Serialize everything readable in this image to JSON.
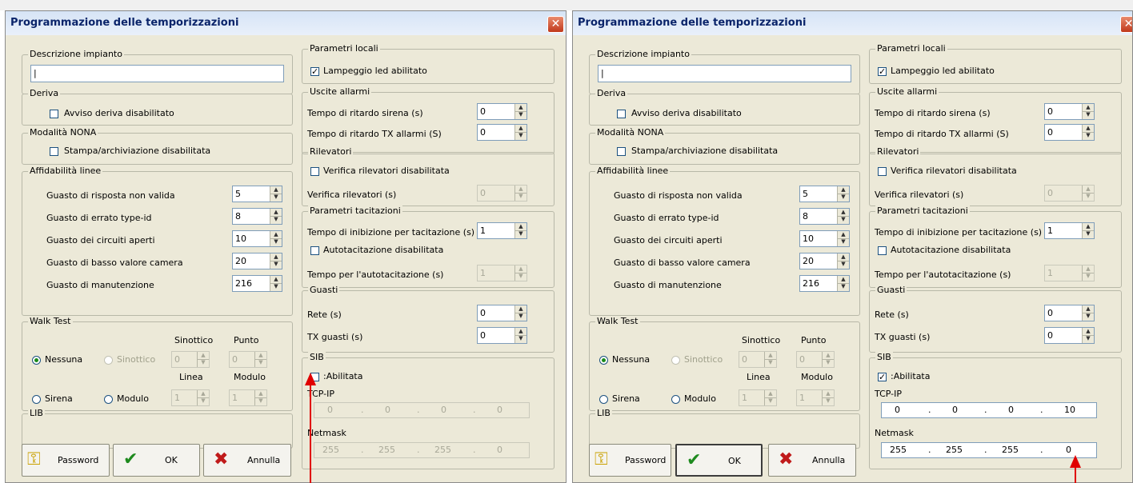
{
  "windows": [
    {
      "title": "Programmazione delle temporizzazioni",
      "close": "✕",
      "descrizione": {
        "label": "Descrizione impianto",
        "value": "|"
      },
      "deriva": {
        "label": "Deriva",
        "check_label": "Avviso deriva disabilitato"
      },
      "nona": {
        "label": "Modalità NONA",
        "check_label": "Stampa/archiviazione disabilitata"
      },
      "affidabilita": {
        "label": "Affidabilità linee",
        "rows": [
          {
            "label": "Guasto di risposta non valida",
            "value": "5"
          },
          {
            "label": "Guasto di errato type-id",
            "value": "8"
          },
          {
            "label": "Guasto dei circuiti aperti",
            "value": "10"
          },
          {
            "label": "Guasto di basso valore camera",
            "value": "20"
          },
          {
            "label": "Guasto di manutenzione",
            "value": "216"
          }
        ]
      },
      "walktest": {
        "label": "Walk Test",
        "sinottico_head": "Sinottico",
        "punto_head": "Punto",
        "linea_head": "Linea",
        "modulo_head": "Modulo",
        "radio_nessuna": "Nessuna",
        "radio_sinottico": "Sinottico",
        "radio_sirena": "Sirena",
        "radio_modulo": "Modulo",
        "sinottico_val": "0",
        "punto_val": "0",
        "linea_val": "1",
        "modulo_val": "1"
      },
      "lib": {
        "label": "LIB"
      },
      "buttons": {
        "password": "Password",
        "ok": "OK",
        "annulla": "Annulla"
      },
      "param_locali": {
        "label": "Parametri locali",
        "check_label": "Lampeggio led abilitato",
        "mark": "✓"
      },
      "uscite": {
        "label": "Uscite allarmi",
        "sirena_label": "Tempo di ritardo sirena (s)",
        "sirena_val": "0",
        "tx_label": "Tempo di ritardo TX allarmi (S)",
        "tx_val": "0"
      },
      "rilevatori": {
        "label": "Rilevatori",
        "check_label": "Verifica rilevatori disabilitata",
        "ver_label": "Verifica rilevatori (s)",
        "ver_val": "0"
      },
      "tacitazioni": {
        "label": "Parametri tacitazioni",
        "inib_label": "Tempo di inibizione per tacitazione (s)",
        "inib_val": "1",
        "check_label": "Autotacitazione disabilitata",
        "auto_label": "Tempo per l'autotacitazione (s)",
        "auto_val": "1"
      },
      "guasti": {
        "label": "Guasti",
        "rete_label": "Rete (s)",
        "rete_val": "0",
        "tx_label": "TX guasti (s)",
        "tx_val": "0"
      },
      "sib": {
        "label": "SIB",
        "check_label": ":Abilitata",
        "mark": "",
        "tcp_label": "TCP-IP",
        "tcp": [
          "0",
          "0",
          "0",
          "0"
        ],
        "netmask_label": "Netmask",
        "netmask": [
          "255",
          "255",
          "255",
          "0"
        ]
      },
      "ip_dot": "."
    },
    {
      "title": "Programmazione delle temporizzazioni",
      "close": "✕",
      "descrizione": {
        "label": "Descrizione impianto",
        "value": "|"
      },
      "deriva": {
        "label": "Deriva",
        "check_label": "Avviso deriva disabilitato"
      },
      "nona": {
        "label": "Modalità NONA",
        "check_label": "Stampa/archiviazione disabilitata"
      },
      "affidabilita": {
        "label": "Affidabilità linee",
        "rows": [
          {
            "label": "Guasto di risposta non valida",
            "value": "5"
          },
          {
            "label": "Guasto di errato type-id",
            "value": "8"
          },
          {
            "label": "Guasto dei circuiti aperti",
            "value": "10"
          },
          {
            "label": "Guasto di basso valore camera",
            "value": "20"
          },
          {
            "label": "Guasto di manutenzione",
            "value": "216"
          }
        ]
      },
      "walktest": {
        "label": "Walk Test",
        "sinottico_head": "Sinottico",
        "punto_head": "Punto",
        "linea_head": "Linea",
        "modulo_head": "Modulo",
        "radio_nessuna": "Nessuna",
        "radio_sinottico": "Sinottico",
        "radio_sirena": "Sirena",
        "radio_modulo": "Modulo",
        "sinottico_val": "0",
        "punto_val": "0",
        "linea_val": "1",
        "modulo_val": "1"
      },
      "lib": {
        "label": "LIB"
      },
      "buttons": {
        "password": "Password",
        "ok": "OK",
        "annulla": "Annulla"
      },
      "param_locali": {
        "label": "Parametri locali",
        "check_label": "Lampeggio led abilitato",
        "mark": "✓"
      },
      "uscite": {
        "label": "Uscite allarmi",
        "sirena_label": "Tempo di ritardo sirena (s)",
        "sirena_val": "0",
        "tx_label": "Tempo di ritardo TX allarmi (S)",
        "tx_val": "0"
      },
      "rilevatori": {
        "label": "Rilevatori",
        "check_label": "Verifica rilevatori disabilitata",
        "ver_label": "Verifica rilevatori (s)",
        "ver_val": "0"
      },
      "tacitazioni": {
        "label": "Parametri tacitazioni",
        "inib_label": "Tempo di inibizione per tacitazione (s)",
        "inib_val": "1",
        "check_label": "Autotacitazione disabilitata",
        "auto_label": "Tempo per l'autotacitazione (s)",
        "auto_val": "1"
      },
      "guasti": {
        "label": "Guasti",
        "rete_label": "Rete (s)",
        "rete_val": "0",
        "tx_label": "TX guasti (s)",
        "tx_val": "0"
      },
      "sib": {
        "label": "SIB",
        "check_label": ":Abilitata",
        "mark": "✓",
        "tcp_label": "TCP-IP",
        "tcp": [
          "0",
          "0",
          "0",
          "10"
        ],
        "netmask_label": "Netmask",
        "netmask": [
          "255",
          "255",
          "255",
          "0"
        ]
      },
      "ip_dot": "."
    }
  ],
  "colors": {
    "annotation_arrow": "#e00000",
    "close_button": "#c0391c",
    "title_text": "#0a246a"
  }
}
